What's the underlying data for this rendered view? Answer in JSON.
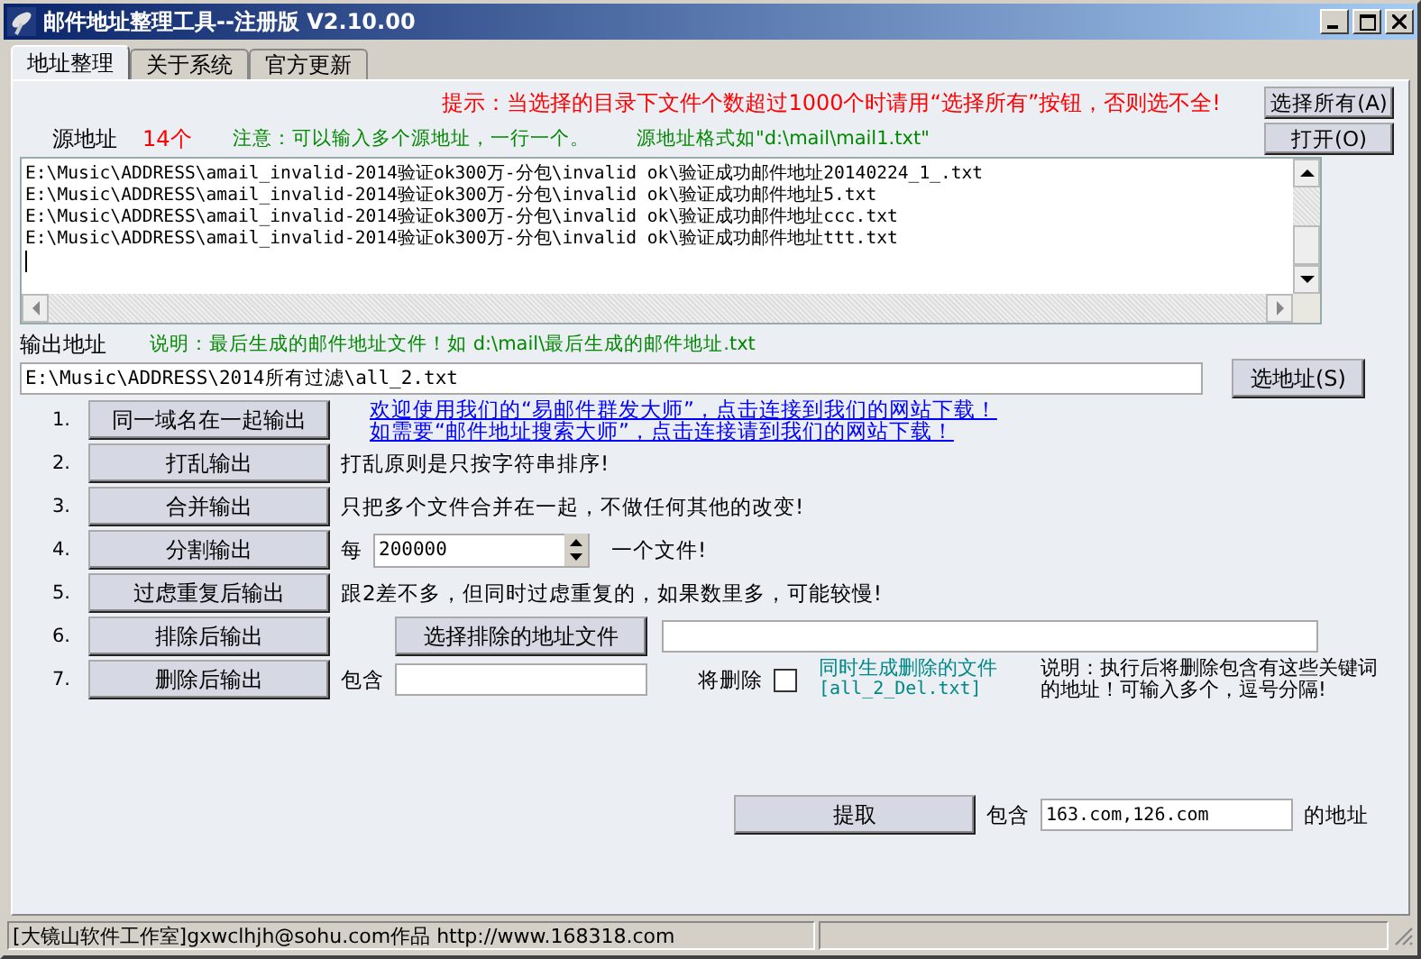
{
  "window": {
    "title": "邮件地址整理工具--注册版 V2.10.00"
  },
  "tabs": [
    {
      "label": "地址整理",
      "selected": true
    },
    {
      "label": "关于系统",
      "selected": false
    },
    {
      "label": "官方更新",
      "selected": false
    }
  ],
  "hint": "提示：当选择的目录下文件个数超过1000个时请用“选择所有”按钮，否则选不全!",
  "select_all_button": "选择所有(A)",
  "source": {
    "label": "源地址",
    "count": "14个",
    "note": "注意：可以输入多个源地址，一行一个。",
    "format": "源地址格式如\"d:\\mail\\mail1.txt\"",
    "open_button": "打开(O)",
    "lines": [
      "E:\\Music\\ADDRESS\\amail_invalid-2014验证ok300万-分包\\invalid ok\\验证成功邮件地址20140224_1_.txt",
      "E:\\Music\\ADDRESS\\amail_invalid-2014验证ok300万-分包\\invalid ok\\验证成功邮件地址5.txt",
      "E:\\Music\\ADDRESS\\amail_invalid-2014验证ok300万-分包\\invalid ok\\验证成功邮件地址ccc.txt",
      "E:\\Music\\ADDRESS\\amail_invalid-2014验证ok300万-分包\\invalid ok\\验证成功邮件地址ttt.txt"
    ]
  },
  "output": {
    "label": "输出地址",
    "note": "说明：最后生成的邮件地址文件！如 d:\\mail\\最后生成的邮件地址.txt",
    "value": "E:\\Music\\ADDRESS\\2014所有过滤\\all_2.txt",
    "button": "选地址(S)"
  },
  "actions": [
    {
      "kind": "links",
      "number": "1.",
      "button": "同一域名在一起输出",
      "links": [
        "欢迎使用我们的“易邮件群发大师”，点击连接到我们的网站下载！",
        "如需要“邮件地址搜索大师”，点击连接请到我们的网站下载！"
      ]
    },
    {
      "kind": "note",
      "number": "2.",
      "button": "打乱输出",
      "note": "打乱原则是只按字符串排序!"
    },
    {
      "kind": "note",
      "number": "3.",
      "button": "合并输出",
      "note": "只把多个文件合并在一起，不做任何其他的改变!"
    },
    {
      "kind": "split",
      "number": "4.",
      "button": "分割输出",
      "prefix": "每",
      "value": "200000",
      "suffix": "一个文件!"
    },
    {
      "kind": "note",
      "number": "5.",
      "button": "过虑重复后输出",
      "note": "跟2差不多，但同时过虑重复的，如果数里多，可能较慢!"
    },
    {
      "kind": "exclude",
      "number": "6.",
      "button": "排除后输出",
      "file_button": "选择排除的地址文件"
    },
    {
      "kind": "delete",
      "number": "7.",
      "button": "删除后输出",
      "prefix": "包含",
      "check_label": "将删除",
      "checked": false,
      "green_note": "同时生成删除的文件",
      "green_file": "[all_2_Del.txt]",
      "description": "说明：执行后将删除包含有这些关键词的地址！可输入多个，逗号分隔!"
    }
  ],
  "extract": {
    "button": "提取",
    "prefix": "包含",
    "value": "163.com,126.com",
    "suffix": "的地址"
  },
  "status_bar": {
    "text": "[大镜山软件工作室]gxwclhjh@sohu.com作品 http://www.168318.com"
  }
}
